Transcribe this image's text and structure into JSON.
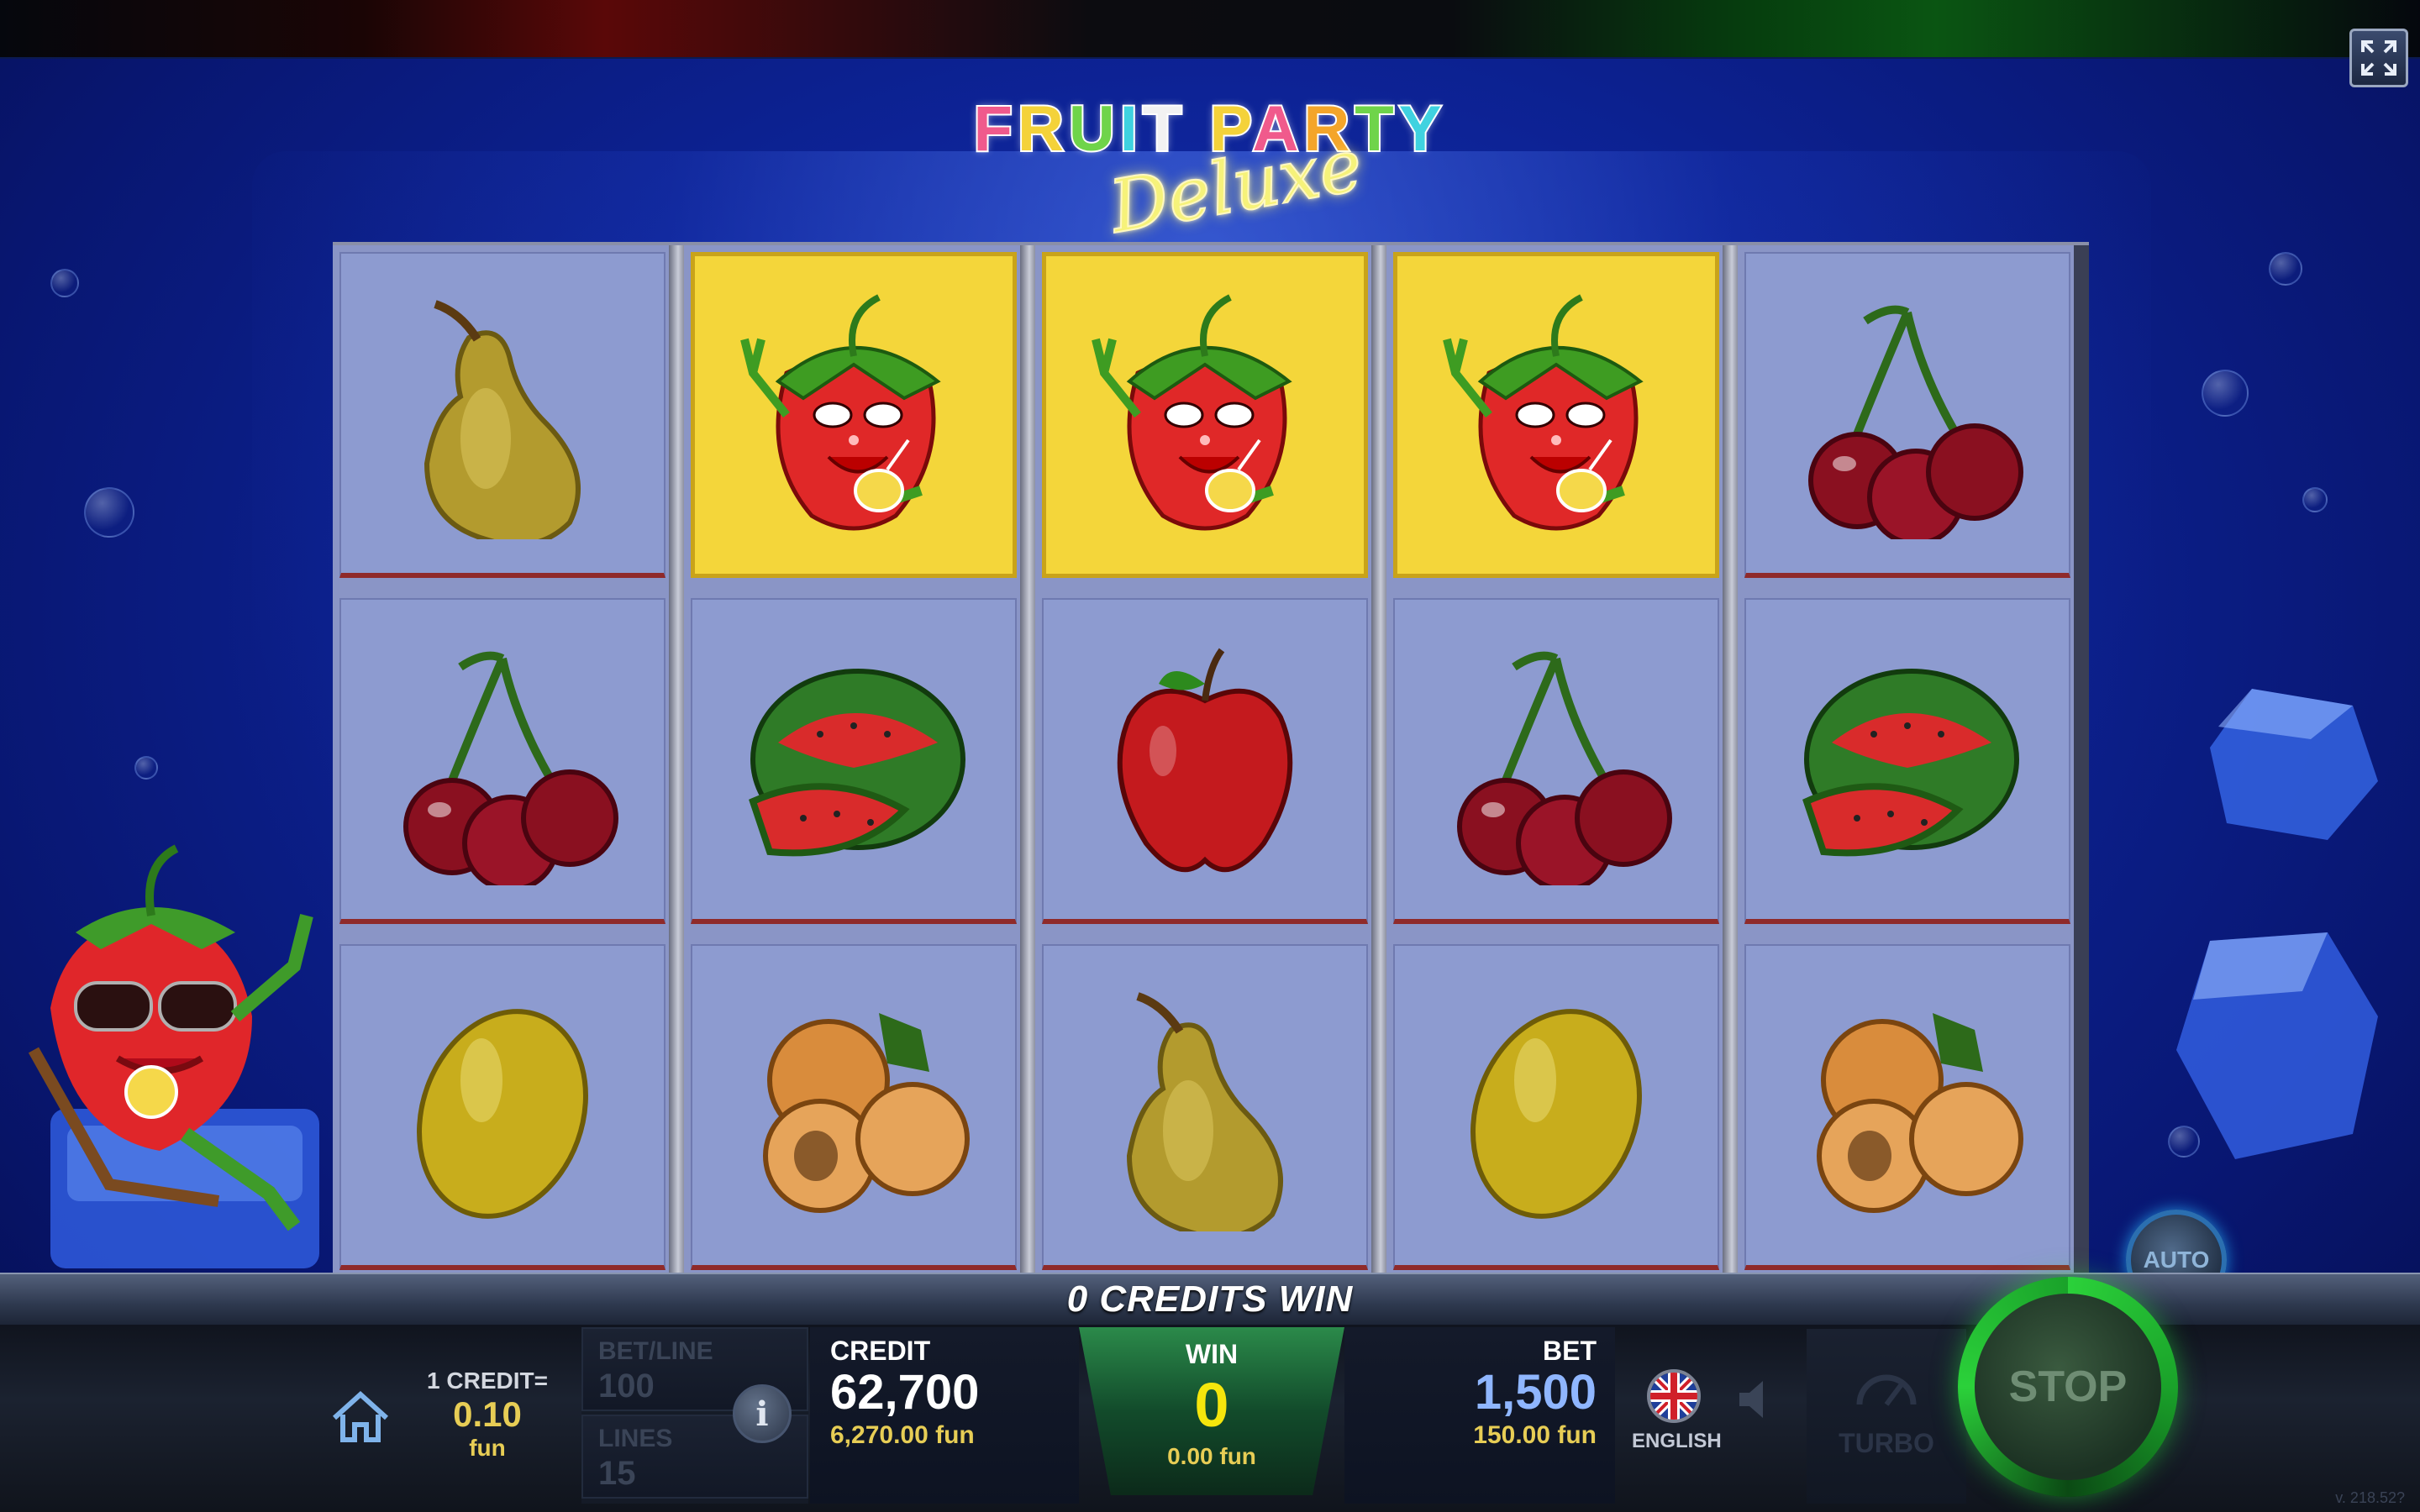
{
  "game": {
    "title_line1": "FRUIT PARTY",
    "title_line2": "Deluxe",
    "title_colors": [
      "#f05a8c",
      "#f4d23a",
      "#6fd44a",
      "#3fd2e0",
      "#f2f2f2",
      "#f4d23a",
      "#f05a8c",
      "#f4a52a",
      "#6fd44a",
      "#3fd2e0",
      "#6fd44a"
    ]
  },
  "controls": {
    "fullscreen_icon": "fullscreen-icon",
    "auto_label": "AUTO",
    "stop_label": "STOP",
    "home_icon": "home-icon",
    "info_label": "i",
    "sound_icon": "speaker-icon",
    "turbo_icon": "speedometer-icon",
    "turbo_label": "TURBO"
  },
  "reels": [
    [
      "pear",
      "cherry",
      "lemon"
    ],
    [
      "strawberry",
      "watermelon",
      "apricot"
    ],
    [
      "strawberry",
      "apple",
      "pear"
    ],
    [
      "strawberry",
      "cherry",
      "lemon"
    ],
    [
      "cherry",
      "watermelon",
      "apricot"
    ]
  ],
  "winning_row": 0,
  "winning_reels": [
    1,
    2,
    3
  ],
  "status": {
    "win_message": "0 CREDITS WIN"
  },
  "panel": {
    "credit_value_label": "1 CREDIT=",
    "credit_value": "0.10",
    "credit_value_unit": "fun",
    "bet_line_label": "BET/LINE",
    "bet_line_value": "100",
    "lines_label": "LINES",
    "lines_value": "15",
    "credit_label": "CREDIT",
    "credit": "62,700",
    "credit_fun": "6,270.00 fun",
    "win_label": "WIN",
    "win": "0",
    "win_fun": "0.00 fun",
    "bet_label": "BET",
    "bet": "1,500",
    "bet_fun": "150.00 fun",
    "language": "ENGLISH",
    "version": "v. 218.52?"
  }
}
